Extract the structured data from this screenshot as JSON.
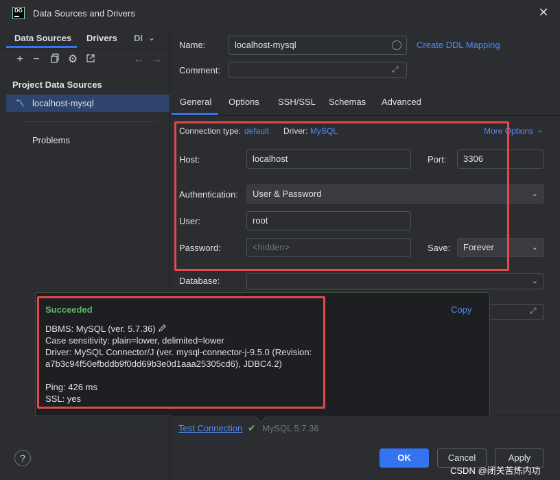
{
  "window": {
    "title": "Data Sources and Drivers",
    "app_logo_text": "DG"
  },
  "left": {
    "tabs": [
      "Data Sources",
      "Drivers",
      "DI"
    ],
    "section_title": "Project Data Sources",
    "selected_item": "localhost-mysql",
    "problems_label": "Problems"
  },
  "form": {
    "name_label": "Name:",
    "name_value": "localhost-mysql",
    "create_ddl_link": "Create DDL Mapping",
    "comment_label": "Comment:",
    "comment_value": ""
  },
  "tabs": [
    "General",
    "Options",
    "SSH/SSL",
    "Schemas",
    "Advanced"
  ],
  "general": {
    "connection_type_label": "Connection type:",
    "connection_type_value": "default",
    "driver_label": "Driver:",
    "driver_value": "MySQL",
    "more_options": "More Options",
    "host_label": "Host:",
    "host_value": "localhost",
    "port_label": "Port:",
    "port_value": "3306",
    "auth_label": "Authentication:",
    "auth_value": "User & Password",
    "user_label": "User:",
    "user_value": "root",
    "password_label": "Password:",
    "password_placeholder": "<hidden>",
    "save_label": "Save:",
    "save_value": "Forever",
    "database_label": "Database:",
    "database_value": ""
  },
  "popup": {
    "status": "Succeeded",
    "copy": "Copy",
    "lines": [
      "DBMS: MySQL (ver. 5.7.36)",
      "Case sensitivity: plain=lower, delimited=lower",
      "Driver: MySQL Connector/J (ver. mysql-connector-j-9.5.0 (Revision:",
      "a7b3c94f50efbddb9f0dd69b3e0d1aaa25305cd6), JDBC4.2)",
      "Ping: 426 ms",
      "SSL: yes"
    ]
  },
  "footer": {
    "test_connection": "Test Connection",
    "version": "MySQL 5.7.36",
    "ok": "OK",
    "cancel": "Cancel",
    "apply": "Apply",
    "help": "?",
    "watermark": "CSDN @闭关苦炼内功"
  },
  "colors": {
    "accent": "#3574f0",
    "link": "#548af7",
    "success": "#5fb865",
    "highlight": "#e5484d"
  }
}
